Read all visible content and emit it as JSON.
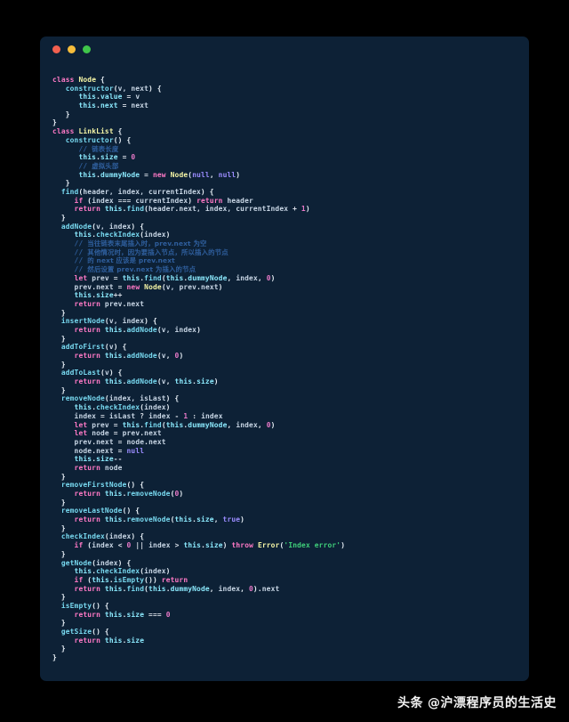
{
  "window": {
    "title": "",
    "traffic_lights": [
      {
        "name": "close",
        "color": "#f2604f"
      },
      {
        "name": "minimize",
        "color": "#f6bd3b"
      },
      {
        "name": "maximize",
        "color": "#3fc64a"
      }
    ],
    "background": "#0d2136",
    "page_background": "#000000"
  },
  "watermark": {
    "brand": "头条",
    "handle": "@沪漂程序员的生活史"
  },
  "editor": {
    "language": "javascript",
    "theme_colors": {
      "keyword": "#ff79c6",
      "function": "#78d9f0",
      "class": "#f6f6a6",
      "variable": "#8be9fd",
      "number": "#e879c8",
      "literal": "#9b8cff",
      "string": "#3fd07a",
      "comment": "#2f5f9e",
      "plain": "#e8f0f7"
    },
    "code_lines": [
      "class Node {",
      "   constructor(v, next) {",
      "      this.value = v",
      "      this.next = next",
      "   }",
      "}",
      "class LinkList {",
      "   constructor() {",
      "      // 链表长度",
      "      this.size = 0",
      "      // 虚拟头部",
      "      this.dummyNode = new Node(null, null)",
      "   }",
      "  find(header, index, currentIndex) {",
      "     if (index === currentIndex) return header",
      "     return this.find(header.next, index, currentIndex + 1)",
      "  }",
      "  addNode(v, index) {",
      "     this.checkIndex(index)",
      "     // 当往链表末尾插入时，prev.next 为空",
      "     // 其他情况时，因为要插入节点，所以插入的节点",
      "     // 的 next 应该是 prev.next",
      "     // 然后设置 prev.next 为插入的节点",
      "     let prev = this.find(this.dummyNode, index, 0)",
      "     prev.next = new Node(v, prev.next)",
      "     this.size++",
      "     return prev.next",
      "  }",
      "  insertNode(v, index) {",
      "     return this.addNode(v, index)",
      "  }",
      "  addToFirst(v) {",
      "     return this.addNode(v, 0)",
      "  }",
      "  addToLast(v) {",
      "     return this.addNode(v, this.size)",
      "  }",
      "  removeNode(index, isLast) {",
      "     this.checkIndex(index)",
      "     index = isLast ? index - 1 : index",
      "     let prev = this.find(this.dummyNode, index, 0)",
      "     let node = prev.next",
      "     prev.next = node.next",
      "     node.next = null",
      "     this.size--",
      "     return node",
      "  }",
      "  removeFirstNode() {",
      "     return this.removeNode(0)",
      "  }",
      "  removeLastNode() {",
      "     return this.removeNode(this.size, true)",
      "  }",
      "  checkIndex(index) {",
      "     if (index < 0 || index > this.size) throw Error('Index error')",
      "  }",
      "  getNode(index) {",
      "     this.checkIndex(index)",
      "     if (this.isEmpty()) return",
      "     return this.find(this.dummyNode, index, 0).next",
      "  }",
      "  isEmpty() {",
      "     return this.size === 0",
      "  }",
      "  getSize() {",
      "     return this.size",
      "  }",
      "}"
    ],
    "highlighted_html": "<span class=\"kw\">class</span> <span class=\"cls\">Node</span> <span class=\"pln\">{</span>\n<span class=\"pln\">   </span><span class=\"fn\">constructor</span><span class=\"pln\">(</span><span class=\"prm\">v, next</span><span class=\"pln\">) {</span>\n<span class=\"pln\">      </span><span class=\"var\">this</span><span class=\"pln\">.</span><span class=\"var\">value</span> <span class=\"op\">=</span> <span class=\"prm\">v</span>\n<span class=\"pln\">      </span><span class=\"var\">this</span><span class=\"pln\">.</span><span class=\"var\">next</span> <span class=\"op\">=</span> <span class=\"prm\">next</span>\n<span class=\"pln\">   }</span>\n<span class=\"pln\">}</span>\n<span class=\"kw\">class</span> <span class=\"cls\">LinkList</span> <span class=\"pln\">{</span>\n<span class=\"pln\">   </span><span class=\"fn\">constructor</span><span class=\"pln\">() {</span>\n<span class=\"pln\">      </span><span class=\"cmt\">// </span><span class=\"cmt-cjk\">链表长度</span>\n<span class=\"pln\">      </span><span class=\"var\">this</span><span class=\"pln\">.</span><span class=\"var\">size</span> <span class=\"op\">=</span> <span class=\"num\">0</span>\n<span class=\"pln\">      </span><span class=\"cmt\">// </span><span class=\"cmt-cjk\">虚拟头部</span>\n<span class=\"pln\">      </span><span class=\"var\">this</span><span class=\"pln\">.</span><span class=\"var\">dummyNode</span> <span class=\"op\">=</span> <span class=\"kw\">new</span> <span class=\"cls\">Node</span><span class=\"pln\">(</span><span class=\"lit\">null</span><span class=\"pln\">, </span><span class=\"lit\">null</span><span class=\"pln\">)</span>\n<span class=\"pln\">   }</span>\n<span class=\"pln\">  </span><span class=\"fn\">find</span><span class=\"pln\">(</span><span class=\"prm\">header, index, currentIndex</span><span class=\"pln\">) {</span>\n<span class=\"pln\">     </span><span class=\"kw\">if</span> <span class=\"pln\">(</span><span class=\"prm\">index</span> <span class=\"op\">===</span> <span class=\"prm\">currentIndex</span><span class=\"pln\">) </span><span class=\"kw\">return</span> <span class=\"prm\">header</span>\n<span class=\"pln\">     </span><span class=\"kw\">return</span> <span class=\"var\">this</span><span class=\"pln\">.</span><span class=\"fn\">find</span><span class=\"pln\">(</span><span class=\"prm\">header</span><span class=\"pln\">.</span><span class=\"prm\">next, index, currentIndex</span> <span class=\"op\">+</span> <span class=\"num\">1</span><span class=\"pln\">)</span>\n<span class=\"pln\">  }</span>\n<span class=\"pln\">  </span><span class=\"fn\">addNode</span><span class=\"pln\">(</span><span class=\"prm\">v, index</span><span class=\"pln\">) {</span>\n<span class=\"pln\">     </span><span class=\"var\">this</span><span class=\"pln\">.</span><span class=\"fn\">checkIndex</span><span class=\"pln\">(</span><span class=\"prm\">index</span><span class=\"pln\">)</span>\n<span class=\"pln\">     </span><span class=\"cmt\">// </span><span class=\"cmt-cjk\">当往链表末尾插入时，prev.next 为空</span>\n<span class=\"pln\">     </span><span class=\"cmt\">// </span><span class=\"cmt-cjk\">其他情况时，因为要插入节点，所以插入的节点</span>\n<span class=\"pln\">     </span><span class=\"cmt\">// </span><span class=\"cmt-cjk\">的 next 应该是 prev.next</span>\n<span class=\"pln\">     </span><span class=\"cmt\">// </span><span class=\"cmt-cjk\">然后设置 prev.next 为插入的节点</span>\n<span class=\"pln\">     </span><span class=\"kw\">let</span> <span class=\"prm\">prev</span> <span class=\"op\">=</span> <span class=\"var\">this</span><span class=\"pln\">.</span><span class=\"fn\">find</span><span class=\"pln\">(</span><span class=\"var\">this</span><span class=\"pln\">.</span><span class=\"var\">dummyNode</span><span class=\"pln\">, </span><span class=\"prm\">index</span><span class=\"pln\">, </span><span class=\"num\">0</span><span class=\"pln\">)</span>\n<span class=\"pln\">     </span><span class=\"prm\">prev</span><span class=\"pln\">.</span><span class=\"prm\">next</span> <span class=\"op\">=</span> <span class=\"kw\">new</span> <span class=\"cls\">Node</span><span class=\"pln\">(</span><span class=\"prm\">v, prev</span><span class=\"pln\">.</span><span class=\"prm\">next</span><span class=\"pln\">)</span>\n<span class=\"pln\">     </span><span class=\"var\">this</span><span class=\"pln\">.</span><span class=\"var\">size</span><span class=\"op\">++</span>\n<span class=\"pln\">     </span><span class=\"kw\">return</span> <span class=\"prm\">prev</span><span class=\"pln\">.</span><span class=\"prm\">next</span>\n<span class=\"pln\">  }</span>\n<span class=\"pln\">  </span><span class=\"fn\">insertNode</span><span class=\"pln\">(</span><span class=\"prm\">v, index</span><span class=\"pln\">) {</span>\n<span class=\"pln\">     </span><span class=\"kw\">return</span> <span class=\"var\">this</span><span class=\"pln\">.</span><span class=\"fn\">addNode</span><span class=\"pln\">(</span><span class=\"prm\">v, index</span><span class=\"pln\">)</span>\n<span class=\"pln\">  }</span>\n<span class=\"pln\">  </span><span class=\"fn\">addToFirst</span><span class=\"pln\">(</span><span class=\"prm\">v</span><span class=\"pln\">) {</span>\n<span class=\"pln\">     </span><span class=\"kw\">return</span> <span class=\"var\">this</span><span class=\"pln\">.</span><span class=\"fn\">addNode</span><span class=\"pln\">(</span><span class=\"prm\">v</span><span class=\"pln\">, </span><span class=\"num\">0</span><span class=\"pln\">)</span>\n<span class=\"pln\">  }</span>\n<span class=\"pln\">  </span><span class=\"fn\">addToLast</span><span class=\"pln\">(</span><span class=\"prm\">v</span><span class=\"pln\">) {</span>\n<span class=\"pln\">     </span><span class=\"kw\">return</span> <span class=\"var\">this</span><span class=\"pln\">.</span><span class=\"fn\">addNode</span><span class=\"pln\">(</span><span class=\"prm\">v</span><span class=\"pln\">, </span><span class=\"var\">this</span><span class=\"pln\">.</span><span class=\"var\">size</span><span class=\"pln\">)</span>\n<span class=\"pln\">  }</span>\n<span class=\"pln\">  </span><span class=\"fn\">removeNode</span><span class=\"pln\">(</span><span class=\"prm\">index, isLast</span><span class=\"pln\">) {</span>\n<span class=\"pln\">     </span><span class=\"var\">this</span><span class=\"pln\">.</span><span class=\"fn\">checkIndex</span><span class=\"pln\">(</span><span class=\"prm\">index</span><span class=\"pln\">)</span>\n<span class=\"pln\">     </span><span class=\"prm\">index</span> <span class=\"op\">=</span> <span class=\"prm\">isLast</span> <span class=\"op\">?</span> <span class=\"prm\">index</span> <span class=\"op\">-</span> <span class=\"num\">1</span> <span class=\"op\">:</span> <span class=\"prm\">index</span>\n<span class=\"pln\">     </span><span class=\"kw\">let</span> <span class=\"prm\">prev</span> <span class=\"op\">=</span> <span class=\"var\">this</span><span class=\"pln\">.</span><span class=\"fn\">find</span><span class=\"pln\">(</span><span class=\"var\">this</span><span class=\"pln\">.</span><span class=\"var\">dummyNode</span><span class=\"pln\">, </span><span class=\"prm\">index</span><span class=\"pln\">, </span><span class=\"num\">0</span><span class=\"pln\">)</span>\n<span class=\"pln\">     </span><span class=\"kw\">let</span> <span class=\"prm\">node</span> <span class=\"op\">=</span> <span class=\"prm\">prev</span><span class=\"pln\">.</span><span class=\"prm\">next</span>\n<span class=\"pln\">     </span><span class=\"prm\">prev</span><span class=\"pln\">.</span><span class=\"prm\">next</span> <span class=\"op\">=</span> <span class=\"prm\">node</span><span class=\"pln\">.</span><span class=\"prm\">next</span>\n<span class=\"pln\">     </span><span class=\"prm\">node</span><span class=\"pln\">.</span><span class=\"prm\">next</span> <span class=\"op\">=</span> <span class=\"lit\">null</span>\n<span class=\"pln\">     </span><span class=\"var\">this</span><span class=\"pln\">.</span><span class=\"var\">size</span><span class=\"op\">--</span>\n<span class=\"pln\">     </span><span class=\"kw\">return</span> <span class=\"prm\">node</span>\n<span class=\"pln\">  }</span>\n<span class=\"pln\">  </span><span class=\"fn\">removeFirstNode</span><span class=\"pln\">() {</span>\n<span class=\"pln\">     </span><span class=\"kw\">return</span> <span class=\"var\">this</span><span class=\"pln\">.</span><span class=\"fn\">removeNode</span><span class=\"pln\">(</span><span class=\"num\">0</span><span class=\"pln\">)</span>\n<span class=\"pln\">  }</span>\n<span class=\"pln\">  </span><span class=\"fn\">removeLastNode</span><span class=\"pln\">() {</span>\n<span class=\"pln\">     </span><span class=\"kw\">return</span> <span class=\"var\">this</span><span class=\"pln\">.</span><span class=\"fn\">removeNode</span><span class=\"pln\">(</span><span class=\"var\">this</span><span class=\"pln\">.</span><span class=\"var\">size</span><span class=\"pln\">, </span><span class=\"lit\">true</span><span class=\"pln\">)</span>\n<span class=\"pln\">  }</span>\n<span class=\"pln\">  </span><span class=\"fn\">checkIndex</span><span class=\"pln\">(</span><span class=\"prm\">index</span><span class=\"pln\">) {</span>\n<span class=\"pln\">     </span><span class=\"kw\">if</span> <span class=\"pln\">(</span><span class=\"prm\">index</span> <span class=\"op\">&lt;</span> <span class=\"num\">0</span> <span class=\"op\">||</span> <span class=\"prm\">index</span> <span class=\"op\">&gt;</span> <span class=\"var\">this</span><span class=\"pln\">.</span><span class=\"var\">size</span><span class=\"pln\">) </span><span class=\"kw\">throw</span> <span class=\"cls\">Error</span><span class=\"pln\">(</span><span class=\"str\">'Index error'</span><span class=\"pln\">)</span>\n<span class=\"pln\">  }</span>\n<span class=\"pln\">  </span><span class=\"fn\">getNode</span><span class=\"pln\">(</span><span class=\"prm\">index</span><span class=\"pln\">) {</span>\n<span class=\"pln\">     </span><span class=\"var\">this</span><span class=\"pln\">.</span><span class=\"fn\">checkIndex</span><span class=\"pln\">(</span><span class=\"prm\">index</span><span class=\"pln\">)</span>\n<span class=\"pln\">     </span><span class=\"kw\">if</span> <span class=\"pln\">(</span><span class=\"var\">this</span><span class=\"pln\">.</span><span class=\"fn\">isEmpty</span><span class=\"pln\">()) </span><span class=\"kw\">return</span>\n<span class=\"pln\">     </span><span class=\"kw\">return</span> <span class=\"var\">this</span><span class=\"pln\">.</span><span class=\"fn\">find</span><span class=\"pln\">(</span><span class=\"var\">this</span><span class=\"pln\">.</span><span class=\"var\">dummyNode</span><span class=\"pln\">, </span><span class=\"prm\">index</span><span class=\"pln\">, </span><span class=\"num\">0</span><span class=\"pln\">).</span><span class=\"prm\">next</span>\n<span class=\"pln\">  }</span>\n<span class=\"pln\">  </span><span class=\"fn\">isEmpty</span><span class=\"pln\">() {</span>\n<span class=\"pln\">     </span><span class=\"kw\">return</span> <span class=\"var\">this</span><span class=\"pln\">.</span><span class=\"var\">size</span> <span class=\"op\">===</span> <span class=\"num\">0</span>\n<span class=\"pln\">  }</span>\n<span class=\"pln\">  </span><span class=\"fn\">getSize</span><span class=\"pln\">() {</span>\n<span class=\"pln\">     </span><span class=\"kw\">return</span> <span class=\"var\">this</span><span class=\"pln\">.</span><span class=\"var\">size</span>\n<span class=\"pln\">  }</span>\n<span class=\"pln\">}</span>"
  }
}
